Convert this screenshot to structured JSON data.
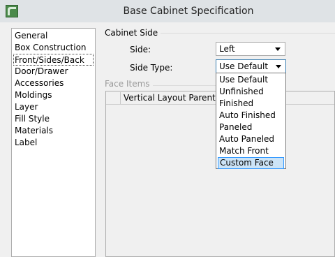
{
  "window": {
    "title": "Base Cabinet Specification"
  },
  "sidebar": {
    "items": [
      {
        "label": "General"
      },
      {
        "label": "Box Construction"
      },
      {
        "label": "Front/Sides/Back"
      },
      {
        "label": "Door/Drawer"
      },
      {
        "label": "Accessories"
      },
      {
        "label": "Moldings"
      },
      {
        "label": "Layer"
      },
      {
        "label": "Fill Style"
      },
      {
        "label": "Materials"
      },
      {
        "label": "Label"
      }
    ],
    "selected": "Front/Sides/Back"
  },
  "cabinet_side": {
    "group_label": "Cabinet Side",
    "side_label": "Side:",
    "side_value": "Left",
    "side_type_label": "Side Type:",
    "side_type_value": "Use Default"
  },
  "face_items": {
    "group_label": "Face Items",
    "column_header": "Vertical Layout Parent"
  },
  "side_type_dropdown": {
    "options": [
      {
        "label": "Use Default"
      },
      {
        "label": "Unfinished"
      },
      {
        "label": "Finished"
      },
      {
        "label": "Auto Finished"
      },
      {
        "label": "Paneled"
      },
      {
        "label": "Auto Paneled"
      },
      {
        "label": "Match Front"
      },
      {
        "label": "Custom Face"
      }
    ],
    "highlighted": "Custom Face"
  }
}
